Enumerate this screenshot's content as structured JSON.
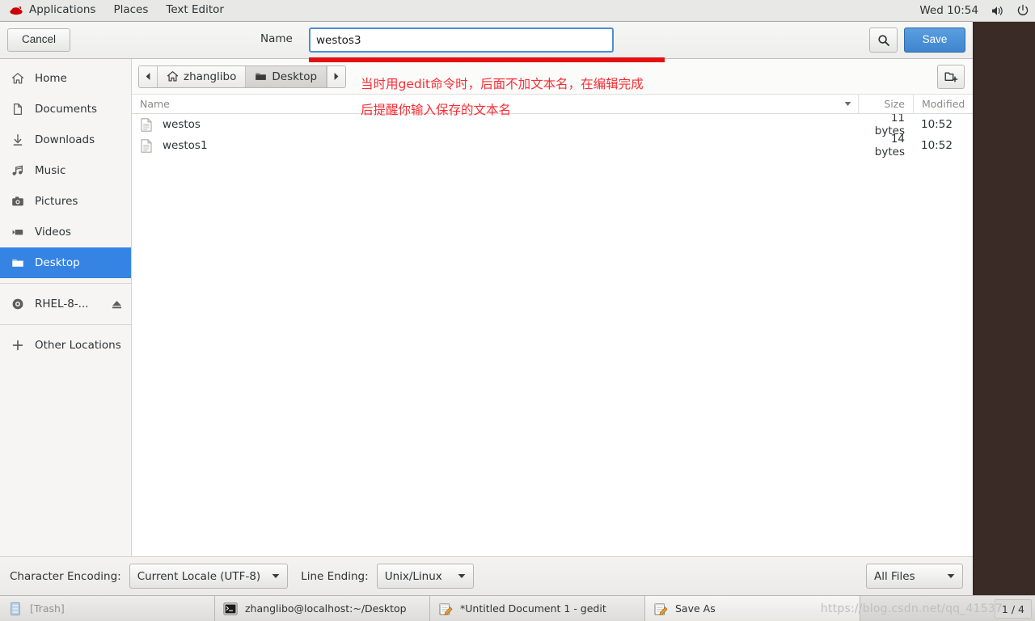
{
  "topbar": {
    "logo_icon": "redhat-logo-icon",
    "items": [
      {
        "label": "Applications"
      },
      {
        "label": "Places"
      },
      {
        "label": "Text Editor"
      }
    ],
    "clock": "Wed 10:54",
    "volume_icon": "speaker-volume-icon",
    "power_icon": "power-icon"
  },
  "dialog": {
    "header": {
      "cancel_label": "Cancel",
      "name_label": "Name",
      "name_value": "westos3",
      "search_icon": "search-icon",
      "save_label": "Save"
    },
    "pathbar": {
      "back_icon": "chevron-left-icon",
      "forward_icon": "chevron-right-icon",
      "crumbs": [
        {
          "label": "zhanglibo",
          "icon": "home-icon",
          "active": false
        },
        {
          "label": "Desktop",
          "icon": "folder-icon",
          "active": true
        }
      ],
      "new_folder_icon": "new-folder-icon"
    },
    "annotations": [
      "当时用gedit命令时，后面不加文本名，在编辑完成",
      "后提醒你输入保存的文本名"
    ],
    "sidebar": {
      "items": [
        {
          "label": "Home",
          "icon": "home-icon",
          "selected": false
        },
        {
          "label": "Documents",
          "icon": "document-icon",
          "selected": false
        },
        {
          "label": "Downloads",
          "icon": "download-icon",
          "selected": false
        },
        {
          "label": "Music",
          "icon": "music-note-icon",
          "selected": false
        },
        {
          "label": "Pictures",
          "icon": "camera-icon",
          "selected": false
        },
        {
          "label": "Videos",
          "icon": "video-camera-icon",
          "selected": false
        },
        {
          "label": "Desktop",
          "icon": "folder-icon",
          "selected": true
        }
      ],
      "devices": [
        {
          "label": "RHEL-8-...",
          "icon": "optical-disc-icon",
          "eject_icon": "eject-icon"
        }
      ],
      "other_locations": {
        "label": "Other Locations",
        "icon": "plus-icon"
      }
    },
    "filelist": {
      "columns": {
        "name": "Name",
        "size": "Size",
        "modified": "Modified"
      },
      "sort_icon": "sort-descending-icon",
      "rows": [
        {
          "name": "westos",
          "icon": "text-file-icon",
          "size": "11 bytes",
          "modified": "10:52"
        },
        {
          "name": "westos1",
          "icon": "text-file-icon",
          "size": "14 bytes",
          "modified": "10:52"
        }
      ]
    },
    "footer": {
      "encoding_label": "Character Encoding:",
      "encoding_value": "Current Locale (UTF-8)",
      "line_ending_label": "Line Ending:",
      "line_ending_value": "Unix/Linux",
      "filter_value": "All Files",
      "caret_icon": "caret-down-icon"
    }
  },
  "taskbar": {
    "tasks": [
      {
        "label": "[Trash]",
        "icon": "trash-icon",
        "dim": true,
        "active": false
      },
      {
        "label": "zhanglibo@localhost:~/Desktop",
        "icon": "terminal-icon",
        "dim": false,
        "active": false
      },
      {
        "label": "*Untitled Document 1 - gedit",
        "icon": "gedit-icon",
        "dim": false,
        "active": false
      },
      {
        "label": "Save As",
        "icon": "gedit-icon",
        "dim": false,
        "active": true
      }
    ],
    "watermark": "https://blog.csdn.net/qq_41537",
    "workspace": "1 / 4"
  },
  "colors": {
    "accent": "#3584e4",
    "annotation": "#fb2c33",
    "desktop": "#3b2b27",
    "save_button": "#3f85ce"
  }
}
